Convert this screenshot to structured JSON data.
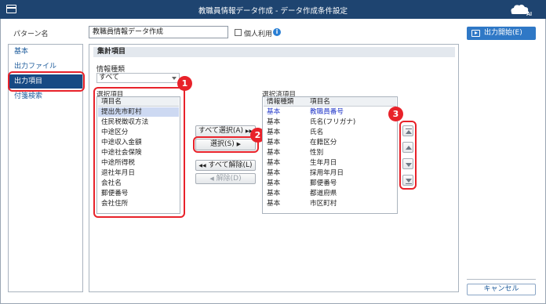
{
  "window": {
    "title": "教職員情報データ作成 - データ作成条件設定"
  },
  "pattern": {
    "label": "パターン名",
    "value": "教職員情報データ作成",
    "checkbox_label": "個人利用",
    "info_glyph": "i"
  },
  "start_button": {
    "label": "出力開始(E)"
  },
  "cancel_button": {
    "label": "キャンセル"
  },
  "sidebar": {
    "items": [
      {
        "label": "基本",
        "active": false
      },
      {
        "label": "出力ファイル",
        "active": false
      },
      {
        "label": "出力項目",
        "active": true
      },
      {
        "label": "付箋検索",
        "active": false
      }
    ]
  },
  "section": {
    "title": "集計項目"
  },
  "info_type": {
    "label": "情報種類",
    "selected": "すべて"
  },
  "available": {
    "label": "選択項目",
    "header": "項目名",
    "items": [
      "提出先市町村",
      "住民税徴収方法",
      "中途区分",
      "中途収入金額",
      "中途社会保険",
      "中途所得税",
      "退社年月日",
      "会社名",
      "郵便番号",
      "会社住所"
    ],
    "selected_index": 0
  },
  "buttons": {
    "select_all": "すべて選択(A)",
    "select": "選択(S)",
    "deselect_all": "すべて解除(L)",
    "deselect": "解除(D)",
    "select_all_glyph": "▶▶",
    "select_glyph": "▶",
    "deselect_all_glyph": "◀◀",
    "deselect_glyph": "◀"
  },
  "chosen": {
    "label": "選択済項目",
    "headers": [
      "情報種類",
      "項目名"
    ],
    "rows": [
      {
        "type": "基本",
        "name": "教職員番号",
        "highlight": true
      },
      {
        "type": "基本",
        "name": "氏名(フリガナ)",
        "highlight": false
      },
      {
        "type": "基本",
        "name": "氏名",
        "highlight": false
      },
      {
        "type": "基本",
        "name": "在籍区分",
        "highlight": false
      },
      {
        "type": "基本",
        "name": "性別",
        "highlight": false
      },
      {
        "type": "基本",
        "name": "生年月日",
        "highlight": false
      },
      {
        "type": "基本",
        "name": "採用年月日",
        "highlight": false
      },
      {
        "type": "基本",
        "name": "郵便番号",
        "highlight": false
      },
      {
        "type": "基本",
        "name": "都道府県",
        "highlight": false
      },
      {
        "type": "基本",
        "name": "市区町村",
        "highlight": false
      }
    ]
  },
  "annotations": [
    "1",
    "2",
    "3"
  ],
  "colors": {
    "titlebar": "#1e4470",
    "active_nav": "#174a84",
    "primary_button": "#2f78c6",
    "callout": "#e8222a",
    "highlight_text": "#2237c9"
  }
}
